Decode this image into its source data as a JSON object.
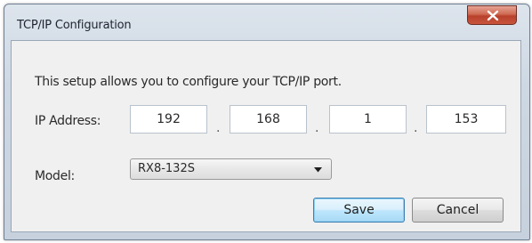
{
  "window": {
    "title": "TCP/IP Configuration"
  },
  "intro_text": "This setup allows you to configure your TCP/IP port.",
  "ip": {
    "label": "IP Address:",
    "octets": [
      "192",
      "168",
      "1",
      "153"
    ],
    "separator": "."
  },
  "model": {
    "label": "Model:",
    "selected": "RX8-132S"
  },
  "buttons": {
    "save": "Save",
    "cancel": "Cancel"
  },
  "colors": {
    "close_button": "#c9553c",
    "default_button_border": "#3c7fb1"
  }
}
